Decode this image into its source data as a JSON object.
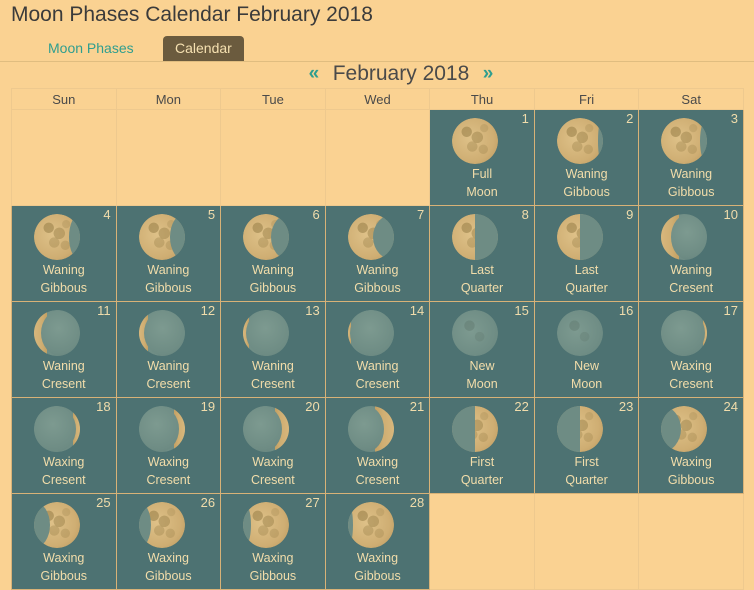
{
  "page": {
    "title": "Moon Phases Calendar February 2018",
    "background_color": "#fad292",
    "cell_color": "#4d7272",
    "accent_color": "#2f9e8f",
    "active_tab_color": "#6b5b3e"
  },
  "tabs": [
    {
      "label": "Moon Phases",
      "active": false
    },
    {
      "label": "Calendar",
      "active": true
    }
  ],
  "month_nav": {
    "prev_icon": "«",
    "next_icon": "»",
    "label": "February 2018"
  },
  "weekday_headers": [
    "Sun",
    "Mon",
    "Tue",
    "Wed",
    "Thu",
    "Fri",
    "Sat"
  ],
  "weeks": [
    [
      {
        "empty": true
      },
      {
        "empty": true
      },
      {
        "empty": true
      },
      {
        "empty": true
      },
      {
        "empty": false,
        "day": "1",
        "line1": "Full",
        "line2": "Moon",
        "phase": "full"
      },
      {
        "empty": false,
        "day": "2",
        "line1": "Waning",
        "line2": "Gibbous",
        "phase": "waning-gibbous-1"
      },
      {
        "empty": false,
        "day": "3",
        "line1": "Waning",
        "line2": "Gibbous",
        "phase": "waning-gibbous-2"
      }
    ],
    [
      {
        "empty": false,
        "day": "4",
        "line1": "Waning",
        "line2": "Gibbous",
        "phase": "waning-gibbous-3"
      },
      {
        "empty": false,
        "day": "5",
        "line1": "Waning",
        "line2": "Gibbous",
        "phase": "waning-gibbous-4"
      },
      {
        "empty": false,
        "day": "6",
        "line1": "Waning",
        "line2": "Gibbous",
        "phase": "waning-gibbous-5"
      },
      {
        "empty": false,
        "day": "7",
        "line1": "Waning",
        "line2": "Gibbous",
        "phase": "waning-gibbous-6"
      },
      {
        "empty": false,
        "day": "8",
        "line1": "Last",
        "line2": "Quarter",
        "phase": "last-quarter"
      },
      {
        "empty": false,
        "day": "9",
        "line1": "Last",
        "line2": "Quarter",
        "phase": "last-quarter"
      },
      {
        "empty": false,
        "day": "10",
        "line1": "Waning",
        "line2": "Cresent",
        "phase": "waning-crescent-1"
      }
    ],
    [
      {
        "empty": false,
        "day": "11",
        "line1": "Waning",
        "line2": "Cresent",
        "phase": "waning-crescent-2"
      },
      {
        "empty": false,
        "day": "12",
        "line1": "Waning",
        "line2": "Cresent",
        "phase": "waning-crescent-3"
      },
      {
        "empty": false,
        "day": "13",
        "line1": "Waning",
        "line2": "Cresent",
        "phase": "waning-crescent-4"
      },
      {
        "empty": false,
        "day": "14",
        "line1": "Waning",
        "line2": "Cresent",
        "phase": "waning-crescent-5"
      },
      {
        "empty": false,
        "day": "15",
        "line1": "New",
        "line2": "Moon",
        "phase": "new"
      },
      {
        "empty": false,
        "day": "16",
        "line1": "New",
        "line2": "Moon",
        "phase": "new"
      },
      {
        "empty": false,
        "day": "17",
        "line1": "Waxing",
        "line2": "Cresent",
        "phase": "waxing-crescent-1"
      }
    ],
    [
      {
        "empty": false,
        "day": "18",
        "line1": "Waxing",
        "line2": "Cresent",
        "phase": "waxing-crescent-2"
      },
      {
        "empty": false,
        "day": "19",
        "line1": "Waxing",
        "line2": "Cresent",
        "phase": "waxing-crescent-3"
      },
      {
        "empty": false,
        "day": "20",
        "line1": "Waxing",
        "line2": "Cresent",
        "phase": "waxing-crescent-4"
      },
      {
        "empty": false,
        "day": "21",
        "line1": "Waxing",
        "line2": "Cresent",
        "phase": "waxing-crescent-5"
      },
      {
        "empty": false,
        "day": "22",
        "line1": "First",
        "line2": "Quarter",
        "phase": "first-quarter"
      },
      {
        "empty": false,
        "day": "23",
        "line1": "First",
        "line2": "Quarter",
        "phase": "first-quarter"
      },
      {
        "empty": false,
        "day": "24",
        "line1": "Waxing",
        "line2": "Gibbous",
        "phase": "waxing-gibbous-1"
      }
    ],
    [
      {
        "empty": false,
        "day": "25",
        "line1": "Waxing",
        "line2": "Gibbous",
        "phase": "waxing-gibbous-2"
      },
      {
        "empty": false,
        "day": "26",
        "line1": "Waxing",
        "line2": "Gibbous",
        "phase": "waxing-gibbous-3"
      },
      {
        "empty": false,
        "day": "27",
        "line1": "Waxing",
        "line2": "Gibbous",
        "phase": "waxing-gibbous-4"
      },
      {
        "empty": false,
        "day": "28",
        "line1": "Waxing",
        "line2": "Gibbous",
        "phase": "waxing-gibbous-5"
      },
      {
        "empty": true
      },
      {
        "empty": true
      },
      {
        "empty": true
      }
    ]
  ]
}
